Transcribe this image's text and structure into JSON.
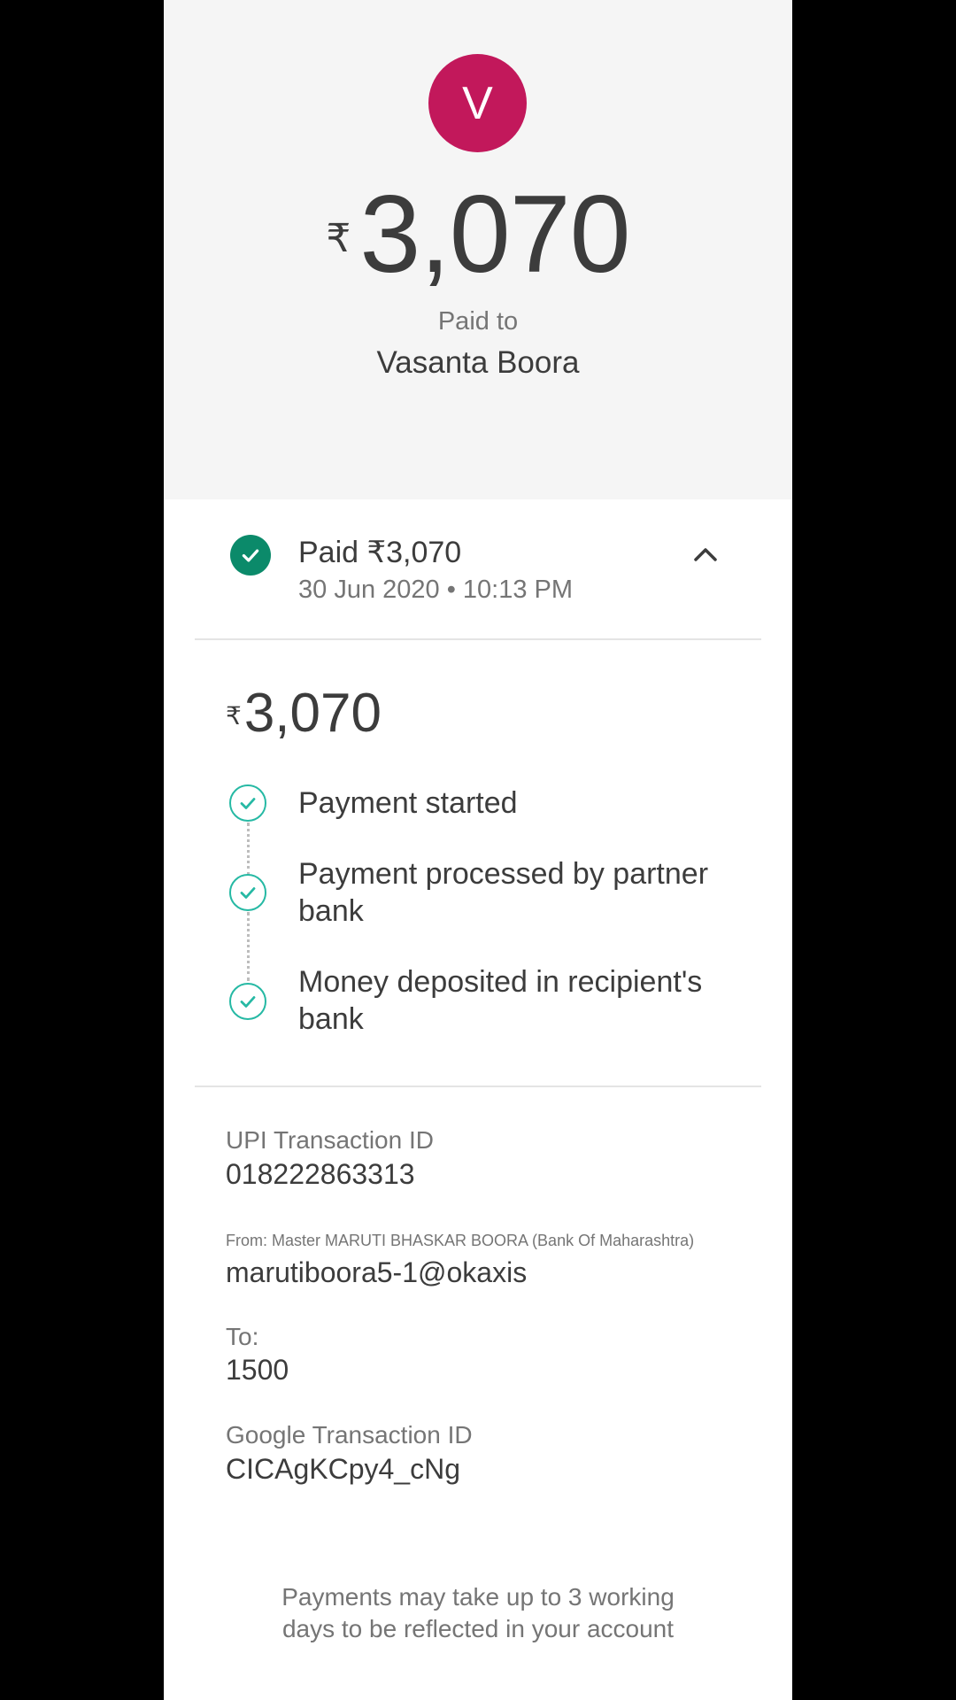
{
  "payee": {
    "initial": "V",
    "avatar_color": "#c2185b",
    "currency_symbol": "₹",
    "amount": "3,070",
    "paid_to_label": "Paid to",
    "name": "Vasanta Boora"
  },
  "status": {
    "icon": "check-circle-icon",
    "title": "Paid ₹3,070",
    "date": "30 Jun 2020 • 10:13 PM",
    "expanded": true
  },
  "breakdown": {
    "currency_symbol": "₹",
    "amount": "3,070",
    "steps": [
      {
        "label": "Payment started",
        "done": true
      },
      {
        "label": "Payment processed by partner bank",
        "done": true
      },
      {
        "label": "Money deposited in recipient's bank",
        "done": true
      }
    ]
  },
  "details": {
    "upi_label": "UPI Transaction ID",
    "upi_value": "018222863313",
    "from_label": "From: Master MARUTI BHASKAR BOORA (Bank Of Maharashtra)",
    "from_value": "marutiboora5-1@okaxis",
    "to_label": "To:",
    "to_value": "1500",
    "google_label": "Google Transaction ID",
    "google_value": "CICAgKCpy4_cNg"
  },
  "footer": {
    "note_line1": "Payments may take up to 3 working",
    "note_line2": "days to be reflected in your account"
  },
  "colors": {
    "success": "#0b8a6a",
    "step_check": "#26b9a4"
  }
}
